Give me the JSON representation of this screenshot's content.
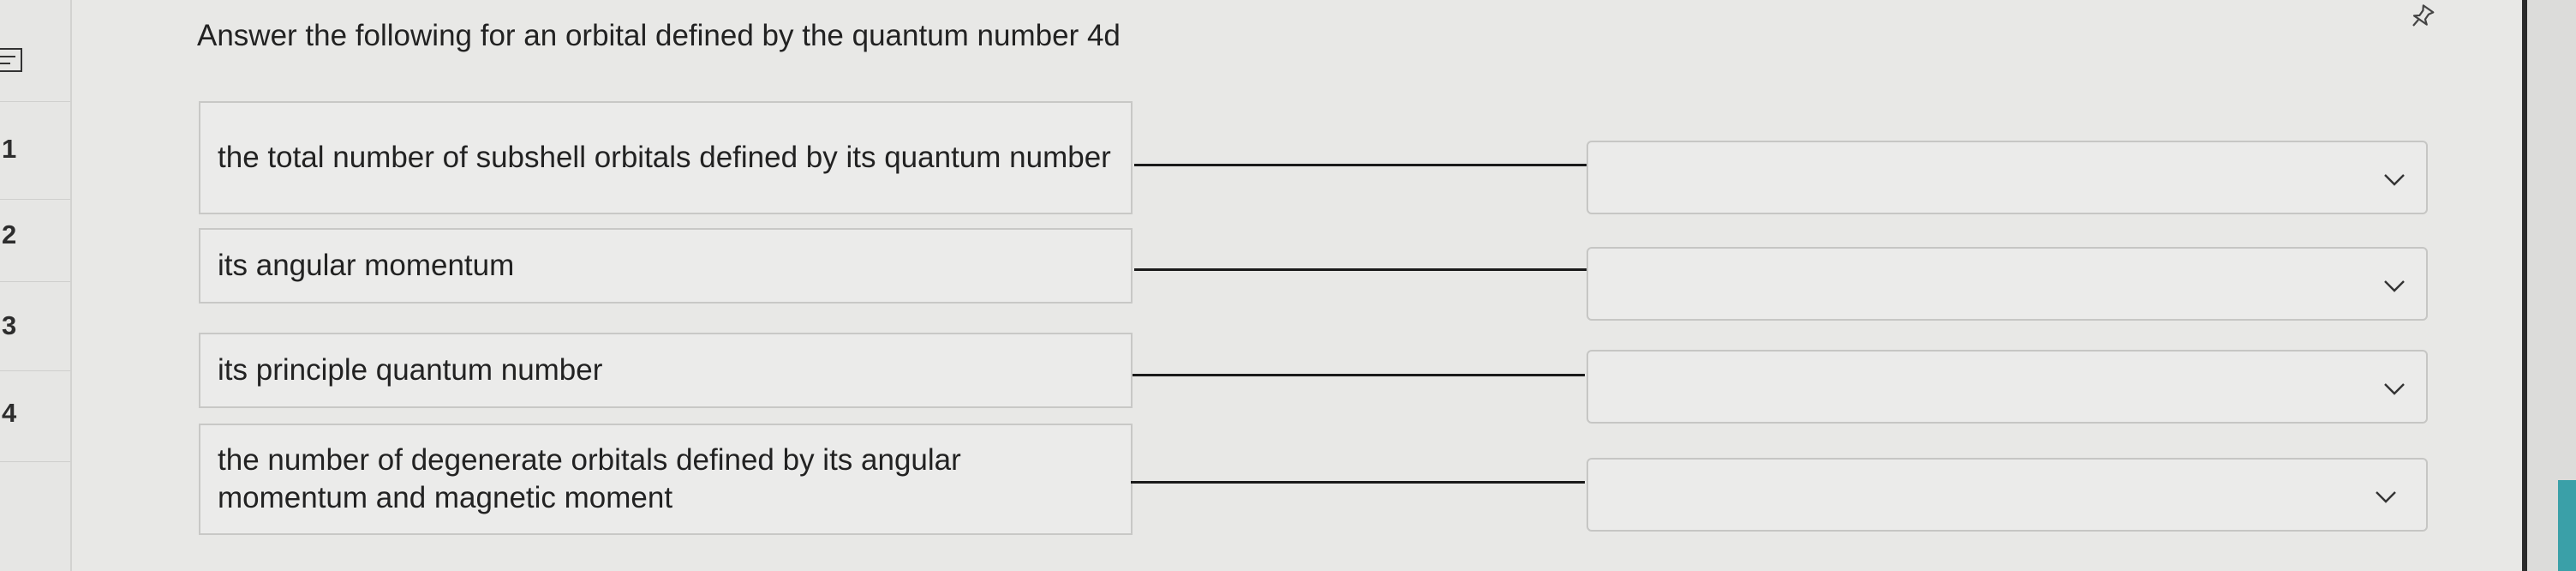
{
  "question": "Answer the following for an orbital defined by the quantum number 4d",
  "rows": [
    {
      "number": "1",
      "prompt": "the total number of subshell orbitals defined by its quantum number",
      "selected": ""
    },
    {
      "number": "2",
      "prompt": "its angular momentum",
      "selected": ""
    },
    {
      "number": "3",
      "prompt": "its principle quantum number",
      "selected": ""
    },
    {
      "number": "4",
      "prompt": "the number of degenerate orbitals defined by its angular momentum and magnetic moment",
      "selected": ""
    }
  ],
  "icons": {
    "rail_top": "list-icon",
    "pin": "pin-icon",
    "dropdown": "chevron-down-icon"
  },
  "colors": {
    "background": "#e8e8e6",
    "accent_teal": "#3aa0a8"
  }
}
